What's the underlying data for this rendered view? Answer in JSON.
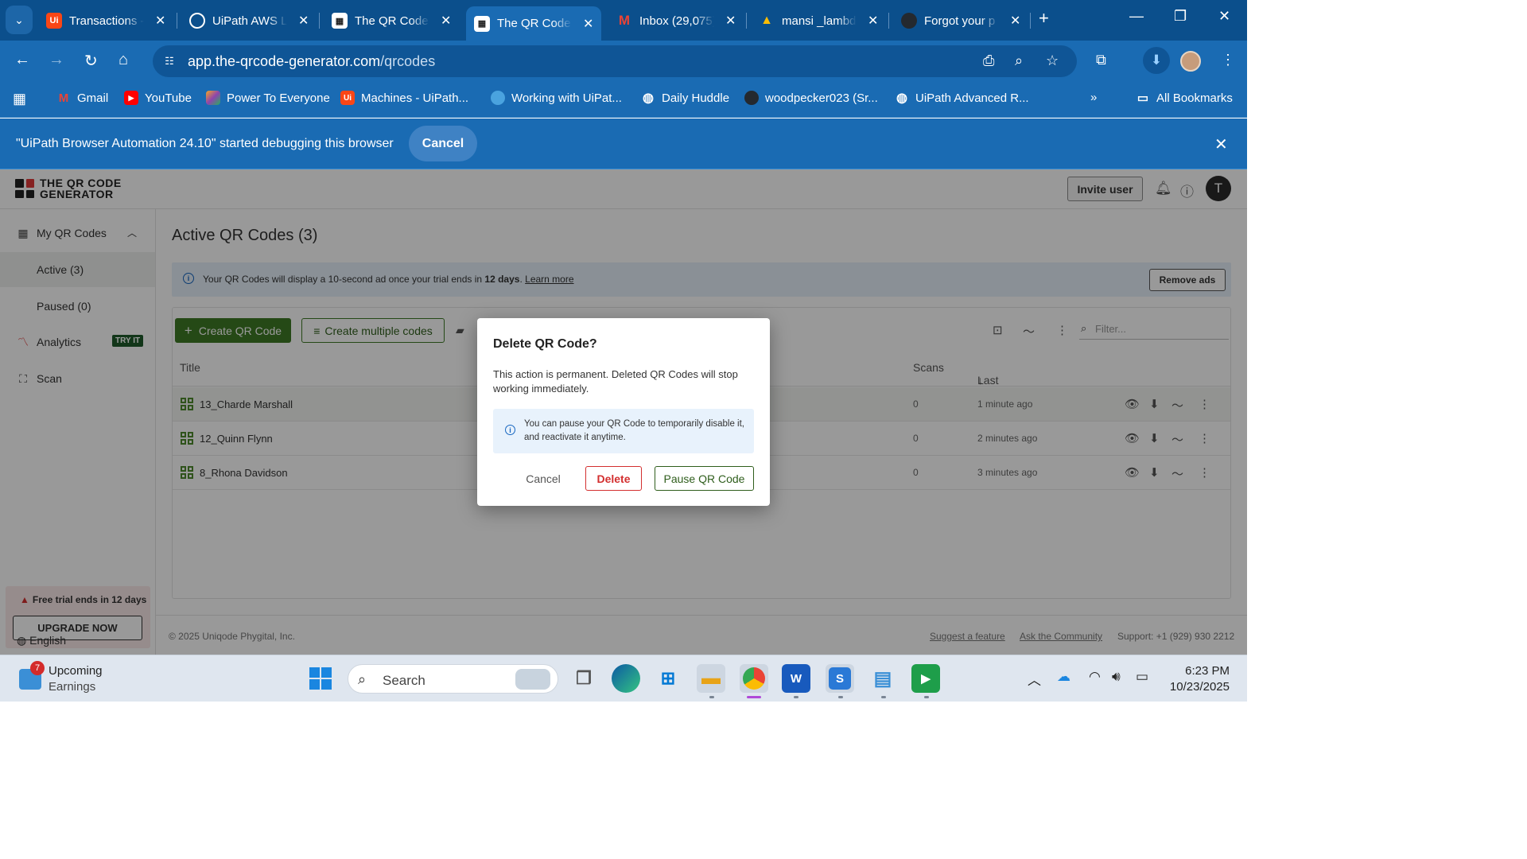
{
  "browser": {
    "tabs": [
      {
        "title": "Transactions -",
        "favicon": "uipath-icon",
        "color": "#fa4616",
        "active": false
      },
      {
        "title": "UiPath AWS La",
        "favicon": "openai-icon",
        "color": "#000000",
        "active": false
      },
      {
        "title": "The QR Code G",
        "favicon": "qrcode-icon",
        "color": "#ffffff",
        "active": false
      },
      {
        "title": "The QR Code G",
        "favicon": "qrcode-icon",
        "color": "#ffffff",
        "active": true
      },
      {
        "title": "Inbox (29,075)",
        "favicon": "gmail-icon",
        "color": "#ea4335",
        "active": false
      },
      {
        "title": "mansi _lambda",
        "favicon": "drive-icon",
        "color": "#fbbc04",
        "active": false
      },
      {
        "title": "Forgot your p",
        "favicon": "github-icon",
        "color": "#24292f",
        "active": false
      }
    ],
    "url_host": "app.the-qrcode-generator.com",
    "url_path": "/qrcodes",
    "bookmarks": [
      {
        "label": "Gmail",
        "icon": "gmail-icon",
        "color": "#ea4335"
      },
      {
        "label": "YouTube",
        "icon": "youtube-icon",
        "color": "#ff0000"
      },
      {
        "label": "Power To Everyone",
        "icon": "power-icon",
        "color": "#8e44ad"
      },
      {
        "label": "Machines - UiPath...",
        "icon": "uipath-icon",
        "color": "#fa4616"
      },
      {
        "label": "Working with UiPat...",
        "icon": "globe-icon",
        "color": "#4aa3df"
      },
      {
        "label": "Daily Huddle",
        "icon": "globe-icon",
        "color": "#ffffff"
      },
      {
        "label": "woodpecker023 (Sr...",
        "icon": "github-icon",
        "color": "#24292f"
      },
      {
        "label": "UiPath Advanced R...",
        "icon": "globe-icon",
        "color": "#ffffff"
      }
    ],
    "all_bookmarks": "All Bookmarks",
    "infobar_text": "\"UiPath Browser Automation 24.10\" started debugging this browser",
    "infobar_cancel": "Cancel"
  },
  "app": {
    "logo_line1": "THE QR CODE",
    "logo_line2": "GENERATOR",
    "invite_user": "Invite user",
    "avatar_initial": "T",
    "sidebar": {
      "my_qr_codes": "My QR Codes",
      "active": "Active (3)",
      "paused": "Paused (0)",
      "analytics": "Analytics",
      "try_it": "TRY IT",
      "scan": "Scan",
      "trial": "Free trial ends in 12 days",
      "upgrade": "UPGRADE NOW",
      "language": "English"
    },
    "page_title": "Active QR Codes (3)",
    "notice": {
      "text_before": "Your QR Codes will display a 10-second ad once your trial ends in ",
      "text_bold": "12 days",
      "text_after": ". ",
      "link": "Learn more",
      "button": "Remove ads"
    },
    "toolbar": {
      "create": "Create QR Code",
      "create_multiple": "Create multiple codes",
      "filter_placeholder": "Filter..."
    },
    "table": {
      "headers": {
        "title": "Title",
        "scans": "Scans",
        "last_modified": "Last modified"
      },
      "rows": [
        {
          "title": "13_Charde Marshall",
          "scans": "0",
          "modified": "1 minute ago"
        },
        {
          "title": "12_Quinn Flynn",
          "scans": "0",
          "modified": "2 minutes ago"
        },
        {
          "title": "8_Rhona Davidson",
          "scans": "0",
          "modified": "3 minutes ago"
        }
      ]
    },
    "footer": {
      "copyright": "© 2025 Uniqode Phygital, Inc.",
      "suggest": "Suggest a feature",
      "community": "Ask the Community",
      "support": "Support:  +1 (929) 930 2212"
    }
  },
  "dialog": {
    "title": "Delete QR Code?",
    "body": "This action is permanent. Deleted QR Codes will stop working immediately.",
    "tip": "You can pause your QR Code to temporarily disable it, and reactivate it anytime.",
    "cancel": "Cancel",
    "delete": "Delete",
    "pause": "Pause QR Code"
  },
  "taskbar": {
    "weather_badge": "7",
    "weather_line1": "Upcoming",
    "weather_line2": "Earnings",
    "search_placeholder": "Search",
    "time": "6:23 PM",
    "date": "10/23/2025"
  }
}
